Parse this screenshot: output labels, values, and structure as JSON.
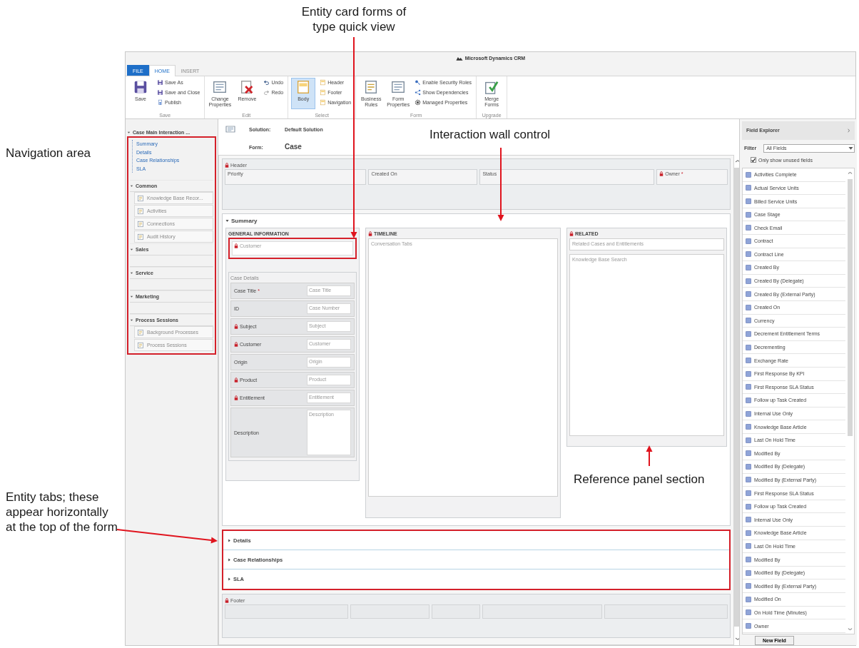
{
  "annotations": [
    {
      "kind": "top",
      "text": "Entity card forms of type quick view"
    },
    {
      "kind": "left",
      "text": "Navigation area"
    },
    {
      "kind": "wall",
      "text": "Interaction wall control"
    },
    {
      "kind": "panel",
      "text": "Reference panel section"
    },
    {
      "kind": "tabs",
      "text": "Entity tabs; these appear horizontally at the top of the form"
    }
  ],
  "window": {
    "title": "Microsoft Dynamics CRM"
  },
  "ribbon": {
    "tabs": [
      {
        "label": "FILE",
        "kind": "file",
        "selected": false
      },
      {
        "label": "HOME",
        "kind": "tab",
        "selected": true
      },
      {
        "label": "INSERT",
        "kind": "tab",
        "selected": false
      }
    ],
    "groups": [
      {
        "label": "Save",
        "buttons": [
          {
            "label": "Save",
            "kind": "large"
          },
          {
            "label": "Save As",
            "kind": "small"
          },
          {
            "label": "Save and Close",
            "kind": "small"
          },
          {
            "label": "Publish",
            "kind": "small"
          }
        ]
      },
      {
        "label": "Edit",
        "buttons": [
          {
            "label": "Change Properties",
            "kind": "large"
          },
          {
            "label": "Remove",
            "kind": "large"
          },
          {
            "label": "Undo",
            "kind": "small"
          },
          {
            "label": "Redo",
            "kind": "small"
          }
        ]
      },
      {
        "label": "Select",
        "buttons": [
          {
            "label": "Body",
            "kind": "large",
            "selected": true
          },
          {
            "label": "Header",
            "kind": "small",
            "selected": false
          },
          {
            "label": "Footer",
            "kind": "small",
            "selected": false
          },
          {
            "label": "Navigation",
            "kind": "small",
            "selected": false
          }
        ]
      },
      {
        "label": "Form",
        "buttons": [
          {
            "label": "Business Rules",
            "kind": "large"
          },
          {
            "label": "Form Properties",
            "kind": "large"
          },
          {
            "label": "Enable Security Roles",
            "kind": "small"
          },
          {
            "label": "Show Dependencies",
            "kind": "small"
          },
          {
            "label": "Managed Properties",
            "kind": "small"
          }
        ]
      },
      {
        "label": "Upgrade",
        "buttons": [
          {
            "label": "Merge Forms",
            "kind": "large"
          }
        ]
      }
    ]
  },
  "navigation": {
    "title": "Case Main Interaction ...",
    "links": [
      {
        "label": "Summary"
      },
      {
        "label": "Details"
      },
      {
        "label": "Case Relationships"
      },
      {
        "label": "SLA"
      }
    ],
    "sections": [
      {
        "label": "Common",
        "items": [
          {
            "label": "Knowledge Base Recor..."
          },
          {
            "label": "Activities"
          },
          {
            "label": "Connections"
          },
          {
            "label": "Audit History"
          }
        ]
      },
      {
        "label": "Sales"
      },
      {
        "label": "Service"
      },
      {
        "label": "Marketing"
      },
      {
        "label": "Process Sessions",
        "items": [
          {
            "label": "Background Processes"
          },
          {
            "label": "Process Sessions"
          }
        ]
      }
    ]
  },
  "form": {
    "solution_label": "Solution:",
    "solution": "Default Solution",
    "form_label": "Form:",
    "form_name": "Case",
    "header": {
      "title": "Header",
      "locked": true,
      "fields": [
        {
          "label": "Priority",
          "locked": false
        },
        {
          "label": "Created On",
          "locked": false
        },
        {
          "label": "Status",
          "locked": false
        },
        {
          "label": "Owner",
          "locked": true,
          "required_mark": "*"
        }
      ]
    },
    "summary": {
      "title": "Summary",
      "expanded": true,
      "general": {
        "title": "GENERAL INFORMATION",
        "quick_view": {
          "placeholder": "Customer",
          "locked": true
        },
        "details_title": "Case Details",
        "rows": [
          {
            "label": "Case Title",
            "required_mark": "*",
            "placeholder": "Case Title",
            "locked": false,
            "kind": "line"
          },
          {
            "label": "ID",
            "placeholder": "Case Number",
            "locked": false,
            "kind": "line"
          },
          {
            "label": "Subject",
            "placeholder": "Subject",
            "locked": true,
            "kind": "line"
          },
          {
            "label": "Customer",
            "placeholder": "Customer",
            "locked": true,
            "kind": "line"
          },
          {
            "label": "Origin",
            "placeholder": "Origin",
            "locked": false,
            "kind": "line"
          },
          {
            "label": "Product",
            "placeholder": "Product",
            "locked": true,
            "kind": "line"
          },
          {
            "label": "Entitlement",
            "placeholder": "Entitlement",
            "locked": true,
            "kind": "line"
          },
          {
            "label": "Description",
            "placeholder": "Description",
            "locked": false,
            "kind": "multiline"
          }
        ]
      },
      "timeline": {
        "title": "TIMELINE",
        "locked": true,
        "placeholder": "Conversation Tabs"
      },
      "related": {
        "title": "RELATED",
        "locked": true,
        "search_placeholder": "Related Cases and Entitlements",
        "list_placeholder": "Knowledge Base Search"
      }
    },
    "tabs": [
      {
        "label": "Details",
        "expanded": false
      },
      {
        "label": "Case Relationships",
        "expanded": false
      },
      {
        "label": "SLA",
        "expanded": false
      }
    ],
    "footer": {
      "title": "Footer",
      "locked": true
    }
  },
  "field_explorer": {
    "title": "Field Explorer",
    "filter_label": "Filter",
    "filter_value": "All Fields",
    "unused_only": {
      "label": "Only show unused fields",
      "checked": true
    },
    "fields": [
      "Activities Complete",
      "Actual Service Units",
      "Billed Service Units",
      "Case Stage",
      "Check Email",
      "Contract",
      "Contract Line",
      "Created By",
      "Created By (Delegate)",
      "Created By (External Party)",
      "Created On",
      "Currency",
      "Decrement Entitlement Terms",
      "Decrementing",
      "Exchange Rate",
      "First Response By KPI",
      "First Response SLA Status",
      "Follow up Task Created",
      "Internal Use Only",
      "Knowledge Base Article",
      "Last On Hold Time",
      "Modified By",
      "Modified By (Delegate)",
      "Modified By (External Party)",
      "First Response SLA Status",
      "Follow up Task Created",
      "Internal Use Only",
      "Knowledge Base Article",
      "Last On Hold Time",
      "Modified By",
      "Modified By (Delegate)",
      "Modified By (External Party)",
      "Modified On",
      "On Hold Time (Minutes)",
      "Owner"
    ],
    "new_button": "New Field"
  }
}
